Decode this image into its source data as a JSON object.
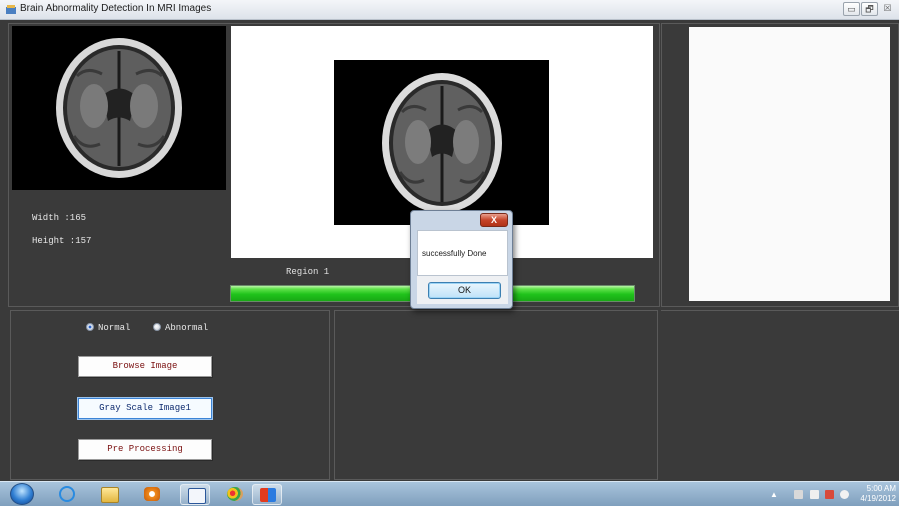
{
  "window": {
    "title": "Brain Abnormality Detection In MRI Images",
    "min_label": "▭",
    "max_label": "🗗",
    "close_label": "☒"
  },
  "image_info": {
    "width_text": "Width :165",
    "height_text": "Height :157"
  },
  "region": {
    "label": "Region 1"
  },
  "progress": {
    "value_percent": 100,
    "color": "#20c31b"
  },
  "options": {
    "normal_label": "Normal",
    "abnormal_label": "Abnormal",
    "selected": "Normal"
  },
  "actions": {
    "browse_label": "Browse Image",
    "gray_label": "Gray Scale Image1",
    "pre_label": "Pre Processing"
  },
  "dialog": {
    "message": "successfully Done",
    "ok_label": "OK",
    "close_label": "X"
  },
  "taskbar": {
    "icons": [
      "start-orb-icon",
      "internet-explorer-icon",
      "file-explorer-icon",
      "media-player-icon",
      "word-icon",
      "paint-icon",
      "matlab-app-icon"
    ],
    "time": "5:00 AM",
    "date": "4/19/2012"
  }
}
